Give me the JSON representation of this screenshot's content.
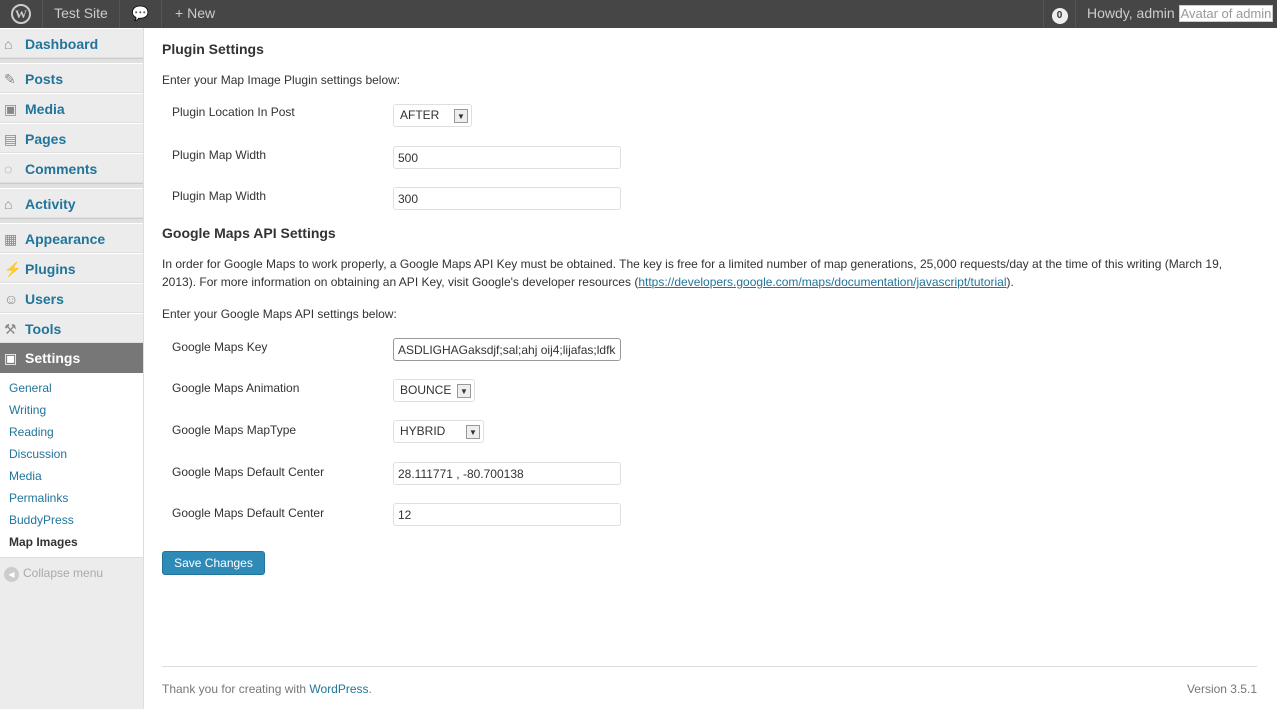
{
  "adminbar": {
    "site": "Test Site",
    "new": "New",
    "notifications": "0",
    "howdy": "Howdy, admin",
    "avatar_alt": "Avatar of admin"
  },
  "sidebar": {
    "items": [
      {
        "label": "Dashboard",
        "icon": "home-icon"
      },
      {
        "label": "Posts",
        "icon": "pin-icon"
      },
      {
        "label": "Media",
        "icon": "media-icon"
      },
      {
        "label": "Pages",
        "icon": "pages-icon"
      },
      {
        "label": "Comments",
        "icon": "comment-icon"
      },
      {
        "label": "Activity",
        "icon": "activity-icon"
      },
      {
        "label": "Appearance",
        "icon": "appearance-icon"
      },
      {
        "label": "Plugins",
        "icon": "plugin-icon"
      },
      {
        "label": "Users",
        "icon": "users-icon"
      },
      {
        "label": "Tools",
        "icon": "tools-icon"
      },
      {
        "label": "Settings",
        "icon": "settings-icon"
      }
    ],
    "submenu": [
      "General",
      "Writing",
      "Reading",
      "Discussion",
      "Media",
      "Permalinks",
      "BuddyPress",
      "Map Images"
    ],
    "collapse": "Collapse menu"
  },
  "main": {
    "title1": "Plugin Settings",
    "intro1": "Enter your Map Image Plugin settings below:",
    "fields1": [
      {
        "label": "Plugin Location In Post",
        "value": "AFTER"
      },
      {
        "label": "Plugin Map Width",
        "value": "500"
      },
      {
        "label": "Plugin Map Width",
        "value": "300"
      }
    ],
    "title2": "Google Maps API Settings",
    "desc": "In order for Google Maps to work properly, a Google Maps API Key must be obtained. The key is free for a limited number of map generations, 25,000 requests/day at the time of this writing (March 19, 2013). For more information on obtaining an API Key, visit Google's developer resources (",
    "link": "https://developers.google.com/maps/documentation/javascript/tutorial",
    "desc_end": ").",
    "intro2": "Enter your Google Maps API settings below:",
    "fields2": [
      {
        "label": "Google Maps Key",
        "value": "ASDLIGHAGaksdjf;sal;ahj oij4;lijafas;ldfk"
      },
      {
        "label": "Google Maps Animation",
        "value": "BOUNCE"
      },
      {
        "label": "Google Maps MapType",
        "value": "HYBRID"
      },
      {
        "label": "Google Maps Default Center",
        "value": "28.111771 , -80.700138"
      },
      {
        "label": "Google Maps Default Center",
        "value": "12"
      }
    ],
    "save": "Save Changes"
  },
  "footer": {
    "thanks": "Thank you for creating with ",
    "wp": "WordPress",
    "thanks_end": ".",
    "version": "Version 3.5.1"
  }
}
